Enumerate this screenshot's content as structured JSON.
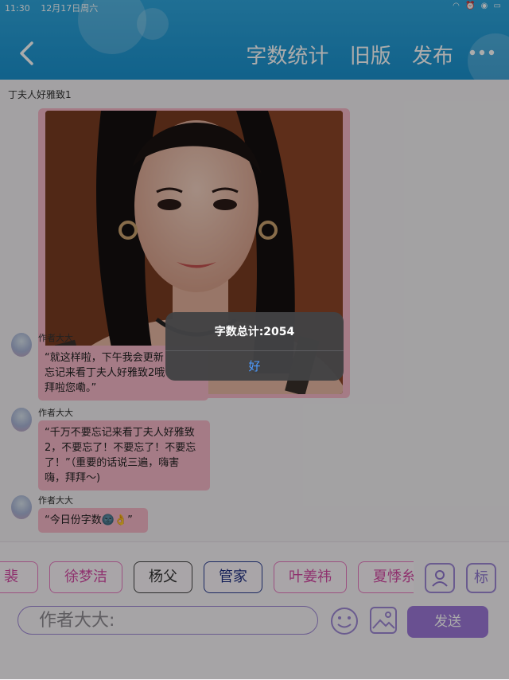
{
  "status_bar": {
    "time": "11:30",
    "date": "12月17日周六"
  },
  "header": {
    "actions": [
      "字数统计",
      "旧版",
      "发布"
    ]
  },
  "chat": {
    "title": "丁夫人好雅致1",
    "messages": [
      {
        "author": "作者大大",
        "text_lines": [
          "“就这样啦，下午我会更新",
          "忘记来看丁夫人好雅致2哦",
          "拜啦您嘞。”"
        ]
      },
      {
        "author": "作者大大",
        "text_lines": [
          "“千万不要忘记来看丁夫人好雅致",
          "2，不要忘了！不要忘了！不要忘",
          "了！”（重要的话说三遍，嗨害",
          "嗨，拜拜～)"
        ]
      },
      {
        "author": "作者大大",
        "text_lines": [
          "“今日份字数🌚👌”"
        ]
      }
    ]
  },
  "composer": {
    "chips": [
      "裴",
      "徐梦洁",
      "杨父",
      "管家",
      "叶姜祎",
      "夏悸糸"
    ],
    "tag_button_label": "标",
    "input_placeholder": "作者大大:",
    "send_label": "发送"
  },
  "dialog": {
    "message": "字数总计:2054",
    "ok_label": "好"
  },
  "colors": {
    "header": "#1f9ad5",
    "bubble": "#f7b8c8",
    "accent": "#9d78d8",
    "chip_border": "#e979c0"
  }
}
